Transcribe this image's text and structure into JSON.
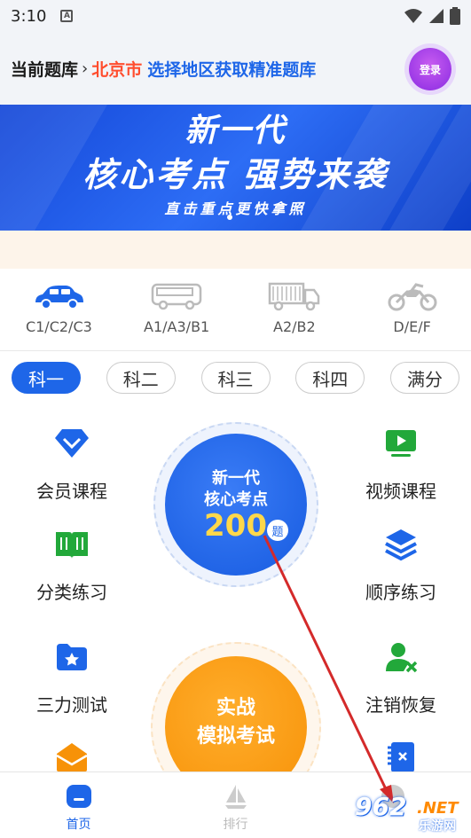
{
  "status_bar": {
    "time": "3:10",
    "notification_icon": "a-letter-icon"
  },
  "header": {
    "label": "当前题库",
    "city": "北京市",
    "select_prompt": "选择地区获取精准题库",
    "login_label": "登录",
    "colors": {
      "city": "#ff4d2e",
      "select": "#1e66e8",
      "login": "#8a2be2"
    }
  },
  "banner": {
    "line1": "新一代",
    "line2": "核心考点 强势来袭",
    "line3": "直击重点更快拿照"
  },
  "vehicles": [
    {
      "icon": "car-icon",
      "label": "C1/C2/C3",
      "active": true
    },
    {
      "icon": "bus-icon",
      "label": "A1/A3/B1",
      "active": false
    },
    {
      "icon": "truck-icon",
      "label": "A2/B2",
      "active": false
    },
    {
      "icon": "motorcycle-icon",
      "label": "D/E/F",
      "active": false
    }
  ],
  "subject_tabs": [
    {
      "label": "科一",
      "active": true
    },
    {
      "label": "科二",
      "active": false
    },
    {
      "label": "科三",
      "active": false
    },
    {
      "label": "科四",
      "active": false
    },
    {
      "label": "满分",
      "active": false
    }
  ],
  "features_left": [
    {
      "icon": "diamond-icon",
      "label": "会员课程"
    },
    {
      "icon": "book-icon",
      "label": "分类练习"
    },
    {
      "icon": "star-folder-icon",
      "label": "三力测试"
    },
    {
      "icon": "mail-icon",
      "label": ""
    }
  ],
  "features_right": [
    {
      "icon": "video-icon",
      "label": "视频课程"
    },
    {
      "icon": "layers-icon",
      "label": "顺序练习"
    },
    {
      "icon": "user-remove-icon",
      "label": "注销恢复"
    },
    {
      "icon": "notebook-icon",
      "label": ""
    }
  ],
  "core_circle": {
    "line1": "新一代",
    "line2": "核心考点",
    "count": "200",
    "unit": "题"
  },
  "exam_circle": {
    "line1": "实战",
    "line2": "模拟考试"
  },
  "bottom_nav": [
    {
      "icon": "home-icon",
      "label": "首页",
      "active": true
    },
    {
      "icon": "sail-icon",
      "label": "排行",
      "active": false
    },
    {
      "icon": "profile-icon",
      "label": "",
      "active": false
    }
  ],
  "watermark": {
    "number": "962",
    "suffix": ".NET",
    "site": "乐游网"
  }
}
